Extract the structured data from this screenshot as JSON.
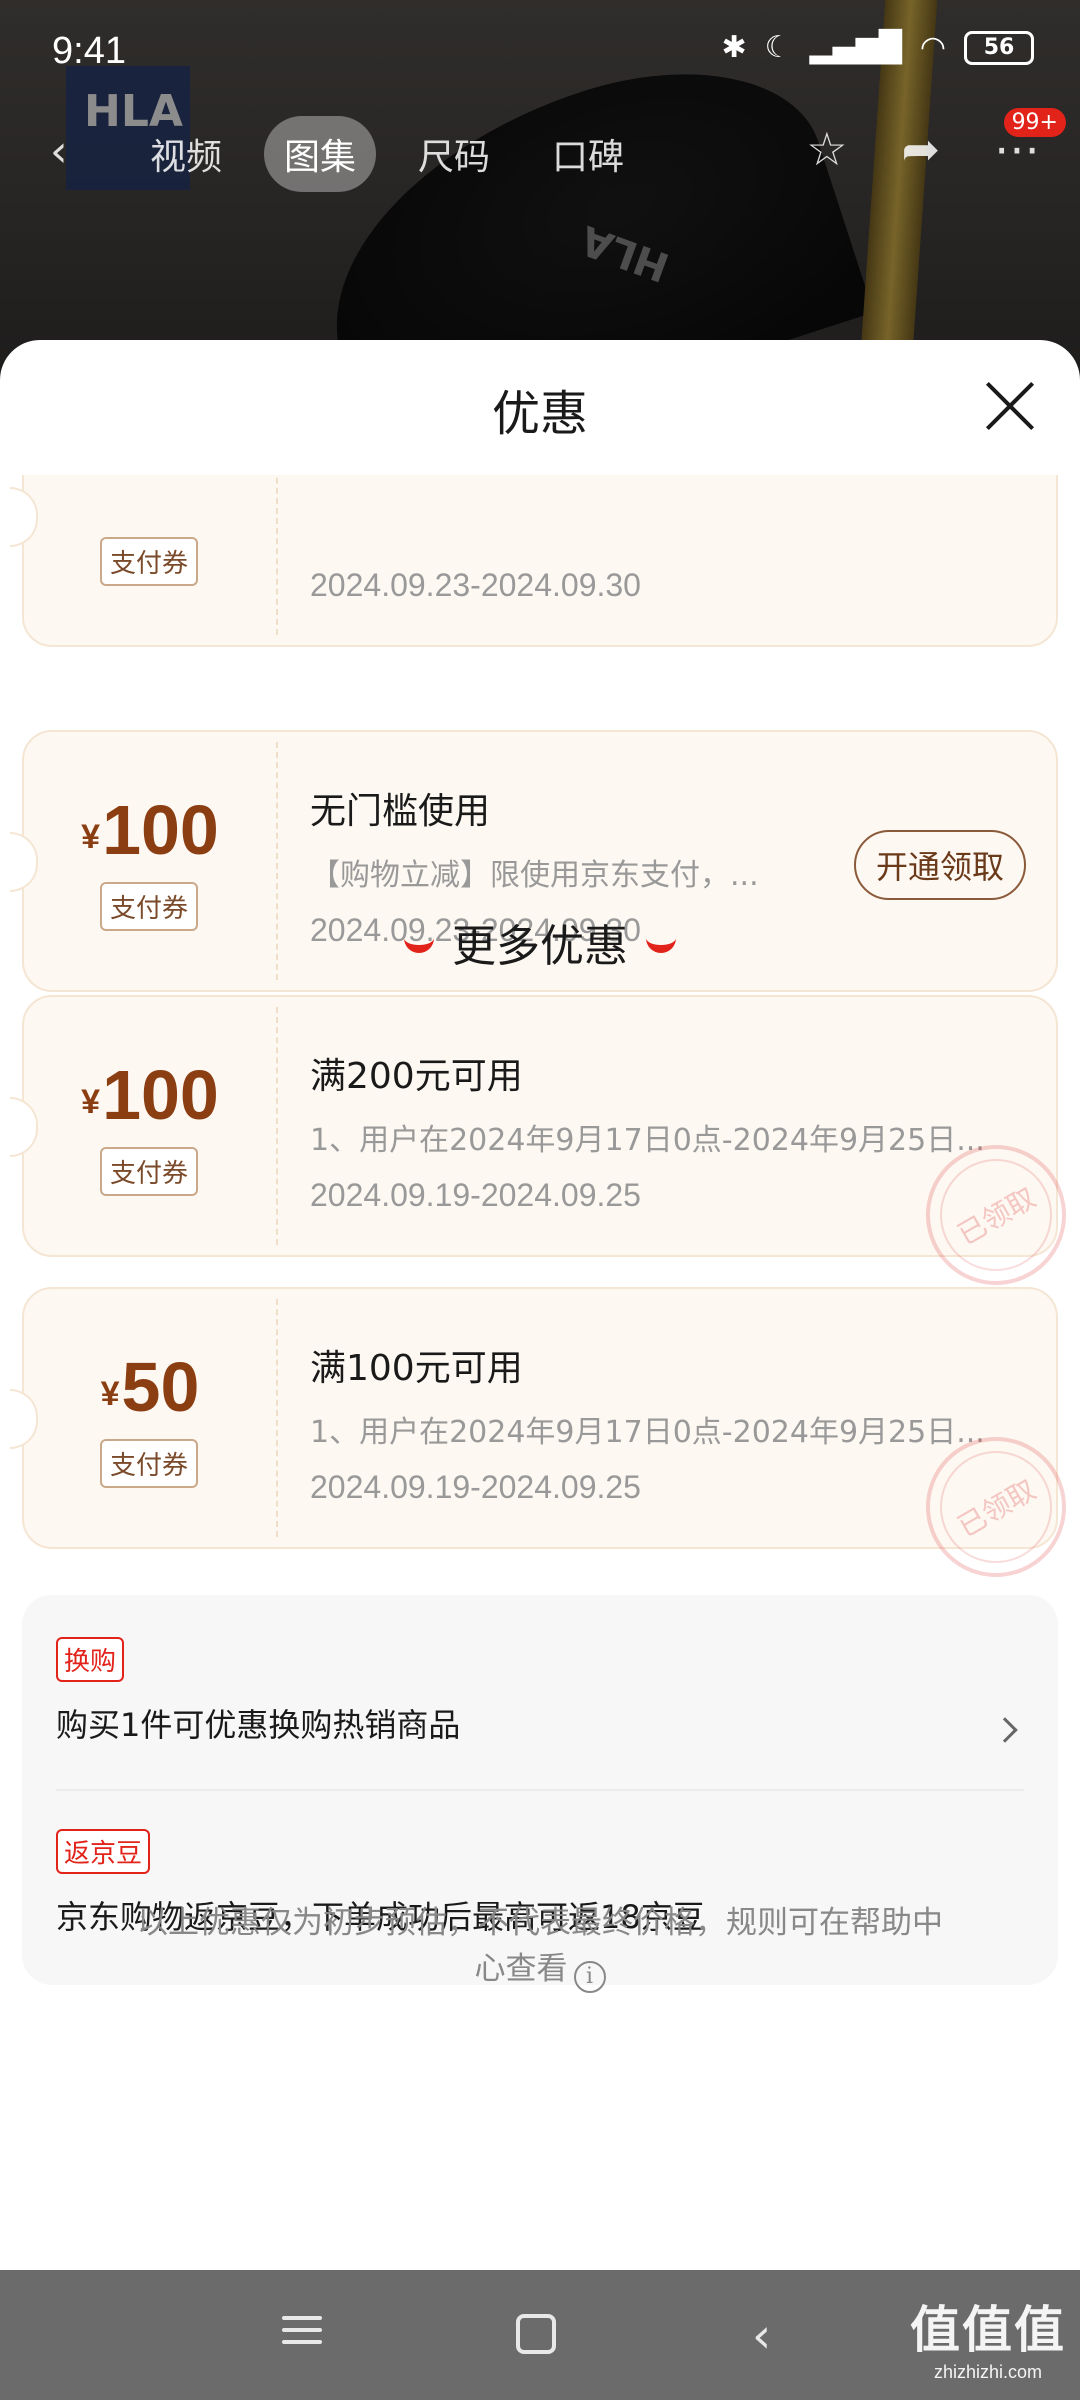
{
  "statusbar": {
    "time": "9:41",
    "battery": "56",
    "icons": [
      "bluetooth-icon",
      "moon-icon",
      "signal-hd-icon",
      "wifi-icon",
      "battery-icon"
    ]
  },
  "background": {
    "logo": "HLA",
    "shoe_brand": "HLA"
  },
  "topnav": {
    "tabs": [
      {
        "label": "视频",
        "active": false
      },
      {
        "label": "图集",
        "active": true
      },
      {
        "label": "尺码",
        "active": false
      },
      {
        "label": "口碑",
        "active": false
      }
    ],
    "badge": "99+"
  },
  "sheet": {
    "title": "优惠",
    "top_partial": {
      "type": "支付券",
      "date": "2024.09.23-2024.09.30"
    },
    "coupons": [
      {
        "currency": "¥",
        "amount": "100",
        "type": "支付券",
        "title": "无门槛使用",
        "desc": "【购物立减】限使用京东支付，...",
        "date": "2024.09.23-2024.09.30",
        "button": "开通领取"
      }
    ],
    "more_title": "更多优惠",
    "more_coupons": [
      {
        "currency": "¥",
        "amount": "100",
        "type": "支付券",
        "title": "满200元可用",
        "desc": "1、用户在2024年9月17日0点-2024年9月25日...",
        "date": "2024.09.19-2024.09.25",
        "stamp": "已领取"
      },
      {
        "currency": "¥",
        "amount": "50",
        "type": "支付券",
        "title": "满100元可用",
        "desc": "1、用户在2024年9月17日0点-2024年9月25日...",
        "date": "2024.09.19-2024.09.25",
        "stamp": "已领取"
      }
    ],
    "extras": [
      {
        "tag": "换购",
        "text": "购买1件可优惠换购热销商品"
      },
      {
        "tag": "返京豆",
        "text": "京东购物返京豆，下单成功后最高可返18京豆"
      }
    ],
    "footnote": "以上优惠仅为初步预估，不代表最终价格，规则可在帮助中心查看"
  },
  "watermark": {
    "main": "值值值",
    "sub": "zhizhizhi.com"
  },
  "colors": {
    "accent": "#e2231a",
    "coupon_amount": "#8a3e12",
    "coupon_bg": "#fdf8f2"
  }
}
